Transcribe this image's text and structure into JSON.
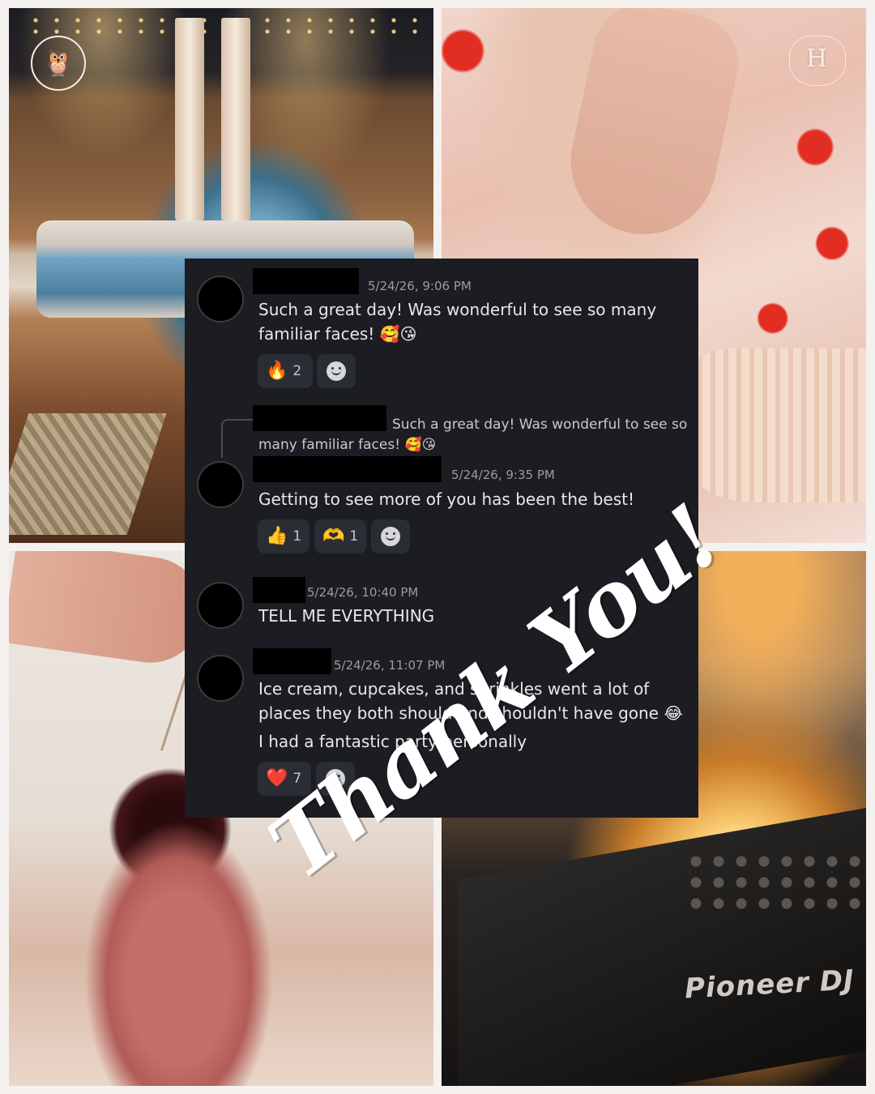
{
  "brand": {
    "owl_logo_icon": "owl-icon",
    "h_logo": "H",
    "deck_brand": "Pioneer DJ"
  },
  "messages": [
    {
      "timestamp": "5/24/26, 9:06 PM",
      "lines": [
        "Such a great day! Was wonderful to see so many",
        "familiar faces! 🥰😘"
      ],
      "reactions": [
        {
          "emoji": "🔥",
          "count": "2"
        }
      ]
    },
    {
      "reply_preview": [
        "Such a great day! Was wonderful to see so",
        "many familiar faces! 🥰😘"
      ],
      "timestamp": "5/24/26, 9:35 PM",
      "lines": [
        "Getting to see more of you has been the best!"
      ],
      "reactions": [
        {
          "emoji": "👍",
          "count": "1"
        },
        {
          "emoji": "🫶",
          "count": "1"
        }
      ]
    },
    {
      "timestamp": "5/24/26, 10:40 PM",
      "lines": [
        "TELL ME EVERYTHING"
      ]
    },
    {
      "timestamp": "5/24/26, 11:07 PM",
      "lines": [
        "Ice cream, cupcakes, and sprinkles went a lot of",
        "places they both should and shouldn't have gone 😂",
        "I had a fantastic party personally"
      ],
      "reactions": [
        {
          "emoji": "❤️",
          "count": "7"
        }
      ]
    }
  ],
  "overlay": {
    "thank_you": "Thank You!"
  }
}
